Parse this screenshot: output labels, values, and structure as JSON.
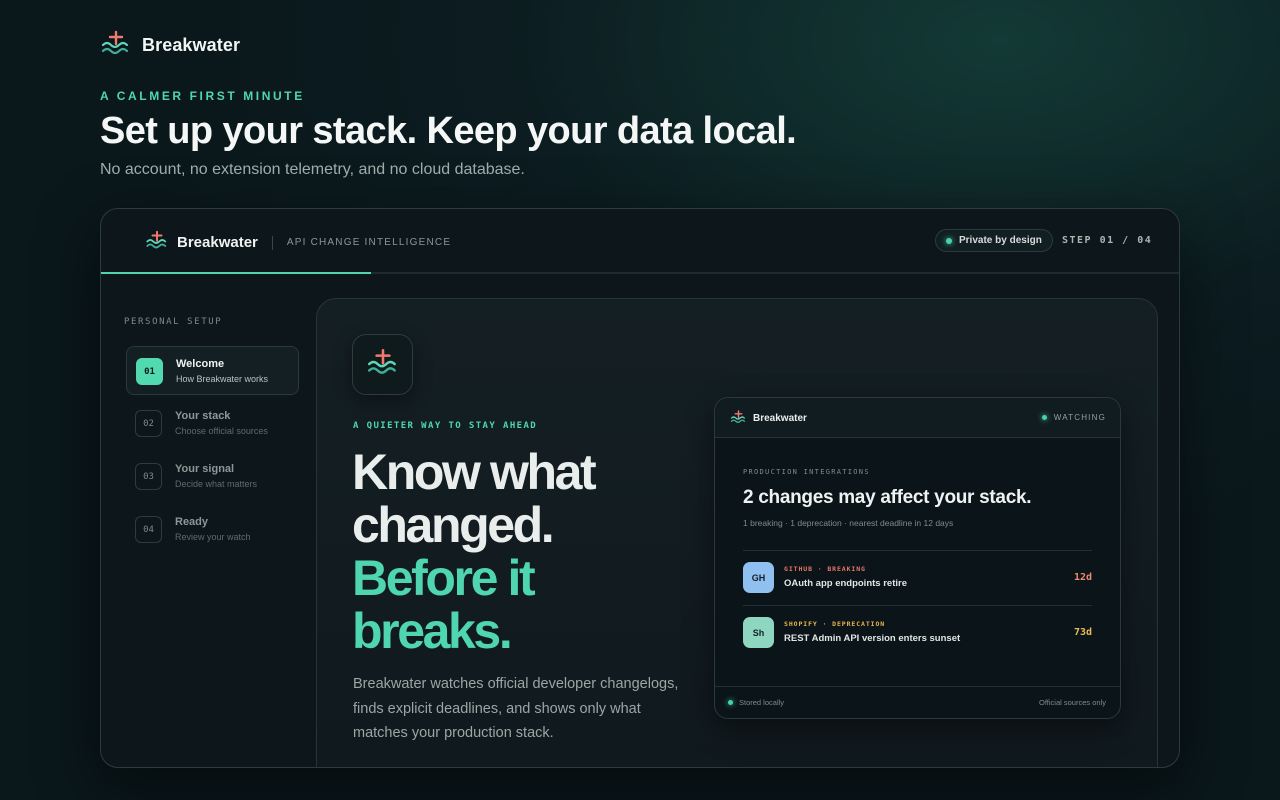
{
  "brand": {
    "name": "Breakwater",
    "icon": "breakwater-logo-icon"
  },
  "intro": {
    "eyebrow": "A CALMER FIRST MINUTE",
    "headline": "Set up your stack. Keep your data local.",
    "subline": "No account, no extension telemetry, and no cloud database."
  },
  "window": {
    "brand_name": "Breakwater",
    "tagline": "API CHANGE INTELLIGENCE",
    "privacy_label": "Private by design",
    "step_label": "STEP 01 / 04",
    "progress": 0.25,
    "accent": "#4fd6b0"
  },
  "sidebar": {
    "title": "PERSONAL SETUP",
    "items": [
      {
        "num": "01",
        "label": "Welcome",
        "desc": "How Breakwater works",
        "active": true
      },
      {
        "num": "02",
        "label": "Your stack",
        "desc": "Choose official sources",
        "active": false
      },
      {
        "num": "03",
        "label": "Your signal",
        "desc": "Decide what matters",
        "active": false
      },
      {
        "num": "04",
        "label": "Ready",
        "desc": "Review your watch",
        "active": false
      }
    ]
  },
  "hero": {
    "eyebrow": "A QUIETER WAY TO STAY AHEAD",
    "title_white_1": "Know what",
    "title_white_2": "changed.",
    "title_green_1": "Before it",
    "title_green_2": "breaks.",
    "body": "Breakwater watches official developer changelogs, finds explicit deadlines, and shows only what matches your production stack."
  },
  "panel": {
    "brand_name": "Breakwater",
    "status": "WATCHING",
    "section": "PRODUCTION INTEGRATIONS",
    "title": "2 changes may affect your stack.",
    "meta": "1 breaking · 1 deprecation · nearest deadline in 12 days",
    "changes": [
      {
        "badge": "GH",
        "badge_color": "#8fc0f0",
        "tag": "GITHUB · BREAKING",
        "tag_color": "#e8766a",
        "text": "OAuth app endpoints retire",
        "days": "12d",
        "days_color": "#ef8a6e"
      },
      {
        "badge": "Sh",
        "badge_color": "#8ed6c0",
        "tag": "SHOPIFY · DEPRECATION",
        "tag_color": "#e6b54c",
        "text": "REST Admin API version enters sunset",
        "days": "73d",
        "days_color": "#e8bd55"
      }
    ],
    "footer_left": "Stored locally",
    "footer_right": "Official sources only"
  }
}
